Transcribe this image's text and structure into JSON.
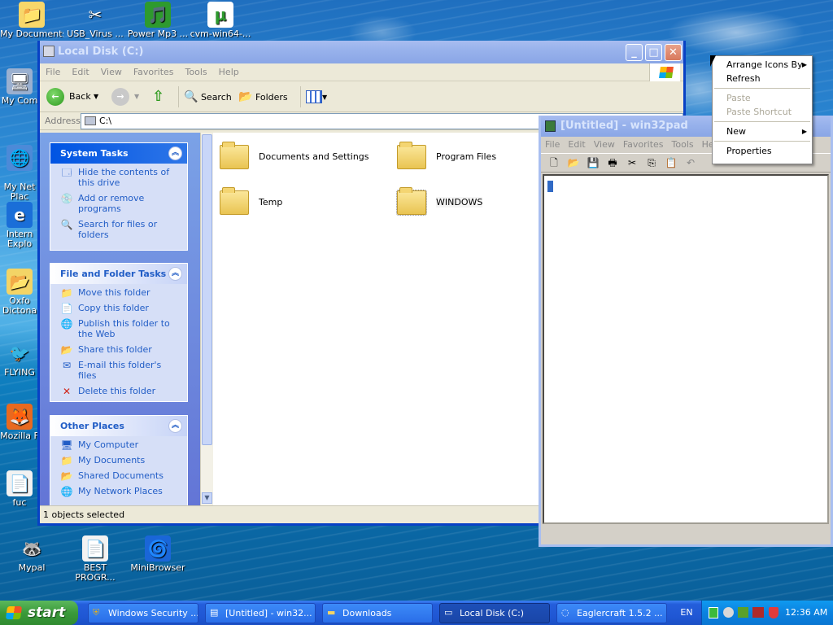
{
  "desktop": {
    "icons": [
      {
        "label": "My Documents",
        "glyph": "📁"
      },
      {
        "label": "USB_Virus ...",
        "glyph": "✂"
      },
      {
        "label": "Power Mp3 ...",
        "glyph": "🎵"
      },
      {
        "label": "cvm-win64-...",
        "glyph": "μ"
      },
      {
        "label": "My Com",
        "glyph": "🖥"
      },
      {
        "label": "My Net\nPlac",
        "glyph": "🌐"
      },
      {
        "label": "Intern\nExplo",
        "glyph": "e"
      },
      {
        "label": "Oxfo\nDictona",
        "glyph": "📂"
      },
      {
        "label": "FLYING",
        "glyph": "🐦"
      },
      {
        "label": "Mozilla F",
        "glyph": "🦊"
      },
      {
        "label": "fuc",
        "glyph": "📄"
      },
      {
        "label": "Mypal",
        "glyph": "🦝"
      },
      {
        "label": "BEST\nPROGR...",
        "glyph": "📄"
      },
      {
        "label": "MiniBrowser",
        "glyph": "🌀"
      }
    ]
  },
  "explorer": {
    "title": "Local Disk (C:)",
    "menus": [
      "File",
      "Edit",
      "View",
      "Favorites",
      "Tools",
      "Help"
    ],
    "toolbar": {
      "back": "Back",
      "search": "Search",
      "folders": "Folders"
    },
    "address_label": "Address",
    "address_value": "C:\\",
    "system_tasks": {
      "title": "System Tasks",
      "items": [
        "Hide the contents of this drive",
        "Add or remove programs",
        "Search for files or folders"
      ]
    },
    "file_tasks": {
      "title": "File and Folder Tasks",
      "items": [
        "Move this folder",
        "Copy this folder",
        "Publish this folder to the Web",
        "Share this folder",
        "E-mail this folder's files",
        "Delete this folder"
      ]
    },
    "other_places": {
      "title": "Other Places",
      "items": [
        "My Computer",
        "My Documents",
        "Shared Documents",
        "My Network Places"
      ]
    },
    "folders": [
      "Documents and Settings",
      "Program Files",
      "Temp",
      "WINDOWS"
    ],
    "status": "1 objects selected"
  },
  "notepad": {
    "title": "[Untitled] - win32pad",
    "menus": [
      "File",
      "Edit",
      "View",
      "Favorites",
      "Tools",
      "Help"
    ]
  },
  "context_menu": {
    "items": [
      {
        "label": "Arrange Icons By",
        "submenu": true,
        "disabled": false
      },
      {
        "label": "Refresh",
        "submenu": false,
        "disabled": false
      },
      {
        "label": "Paste",
        "submenu": false,
        "disabled": true
      },
      {
        "label": "Paste Shortcut",
        "submenu": false,
        "disabled": true
      },
      {
        "label": "New",
        "submenu": true,
        "disabled": false
      },
      {
        "label": "Properties",
        "submenu": false,
        "disabled": false
      }
    ]
  },
  "taskbar": {
    "start": "start",
    "tasks": [
      "Windows Security ...",
      "[Untitled] - win32...",
      "Downloads",
      "Local Disk (C:)",
      "Eaglercraft 1.5.2 ..."
    ],
    "language": "EN",
    "clock": "12:36 AM"
  }
}
